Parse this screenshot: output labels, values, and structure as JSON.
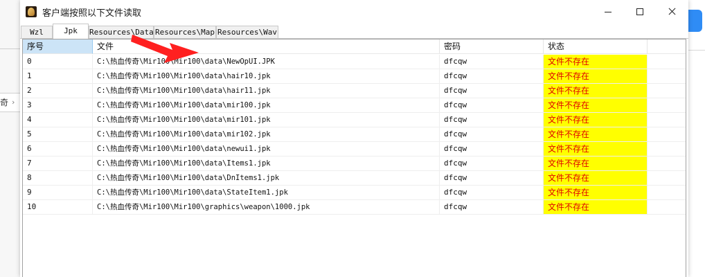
{
  "window": {
    "title": "客户端按照以下文件读取"
  },
  "tabs": [
    {
      "label": "Wzl",
      "active": false
    },
    {
      "label": "Jpk",
      "active": true
    },
    {
      "label": "Resources\\Data",
      "active": false
    },
    {
      "label": "Resources\\Map",
      "active": false
    },
    {
      "label": "Resources\\Wav",
      "active": false
    }
  ],
  "table": {
    "headers": [
      "序号",
      "文件",
      "密码",
      "状态"
    ],
    "rows": [
      {
        "index": "0",
        "file": "C:\\热血传奇\\Mir100\\Mir100\\data\\NewOpUI.JPK",
        "password": "dfcqw",
        "status": "文件不存在"
      },
      {
        "index": "1",
        "file": "C:\\热血传奇\\Mir100\\Mir100\\data\\hair10.jpk",
        "password": "dfcqw",
        "status": "文件不存在"
      },
      {
        "index": "2",
        "file": "C:\\热血传奇\\Mir100\\Mir100\\data\\hair11.jpk",
        "password": "dfcqw",
        "status": "文件不存在"
      },
      {
        "index": "3",
        "file": "C:\\热血传奇\\Mir100\\Mir100\\data\\mir100.jpk",
        "password": "dfcqw",
        "status": "文件不存在"
      },
      {
        "index": "4",
        "file": "C:\\热血传奇\\Mir100\\Mir100\\data\\mir101.jpk",
        "password": "dfcqw",
        "status": "文件不存在"
      },
      {
        "index": "5",
        "file": "C:\\热血传奇\\Mir100\\Mir100\\data\\mir102.jpk",
        "password": "dfcqw",
        "status": "文件不存在"
      },
      {
        "index": "6",
        "file": "C:\\热血传奇\\Mir100\\Mir100\\data\\newui1.jpk",
        "password": "dfcqw",
        "status": "文件不存在"
      },
      {
        "index": "7",
        "file": "C:\\热血传奇\\Mir100\\Mir100\\data\\Items1.jpk",
        "password": "dfcqw",
        "status": "文件不存在"
      },
      {
        "index": "8",
        "file": "C:\\热血传奇\\Mir100\\Mir100\\data\\DnItems1.jpk",
        "password": "dfcqw",
        "status": "文件不存在"
      },
      {
        "index": "9",
        "file": "C:\\热血传奇\\Mir100\\Mir100\\data\\StateItem1.jpk",
        "password": "dfcqw",
        "status": "文件不存在"
      },
      {
        "index": "10",
        "file": "C:\\热血传奇\\Mir100\\Mir100\\graphics\\weapon\\1000.jpk",
        "password": "dfcqw",
        "status": "文件不存在"
      }
    ]
  },
  "background": {
    "left_fragment_text": "奇"
  },
  "colors": {
    "status_bg": "#ffff00",
    "status_text": "#e00000",
    "selected_header": "#cce4f7",
    "annotation_arrow": "#ff2020",
    "accent": "#2f8cf5"
  },
  "icons": {
    "app": "game-app-icon",
    "minimize": "minimize-icon",
    "maximize": "maximize-icon",
    "close": "close-icon",
    "annotation": "red-arrow-icon"
  }
}
